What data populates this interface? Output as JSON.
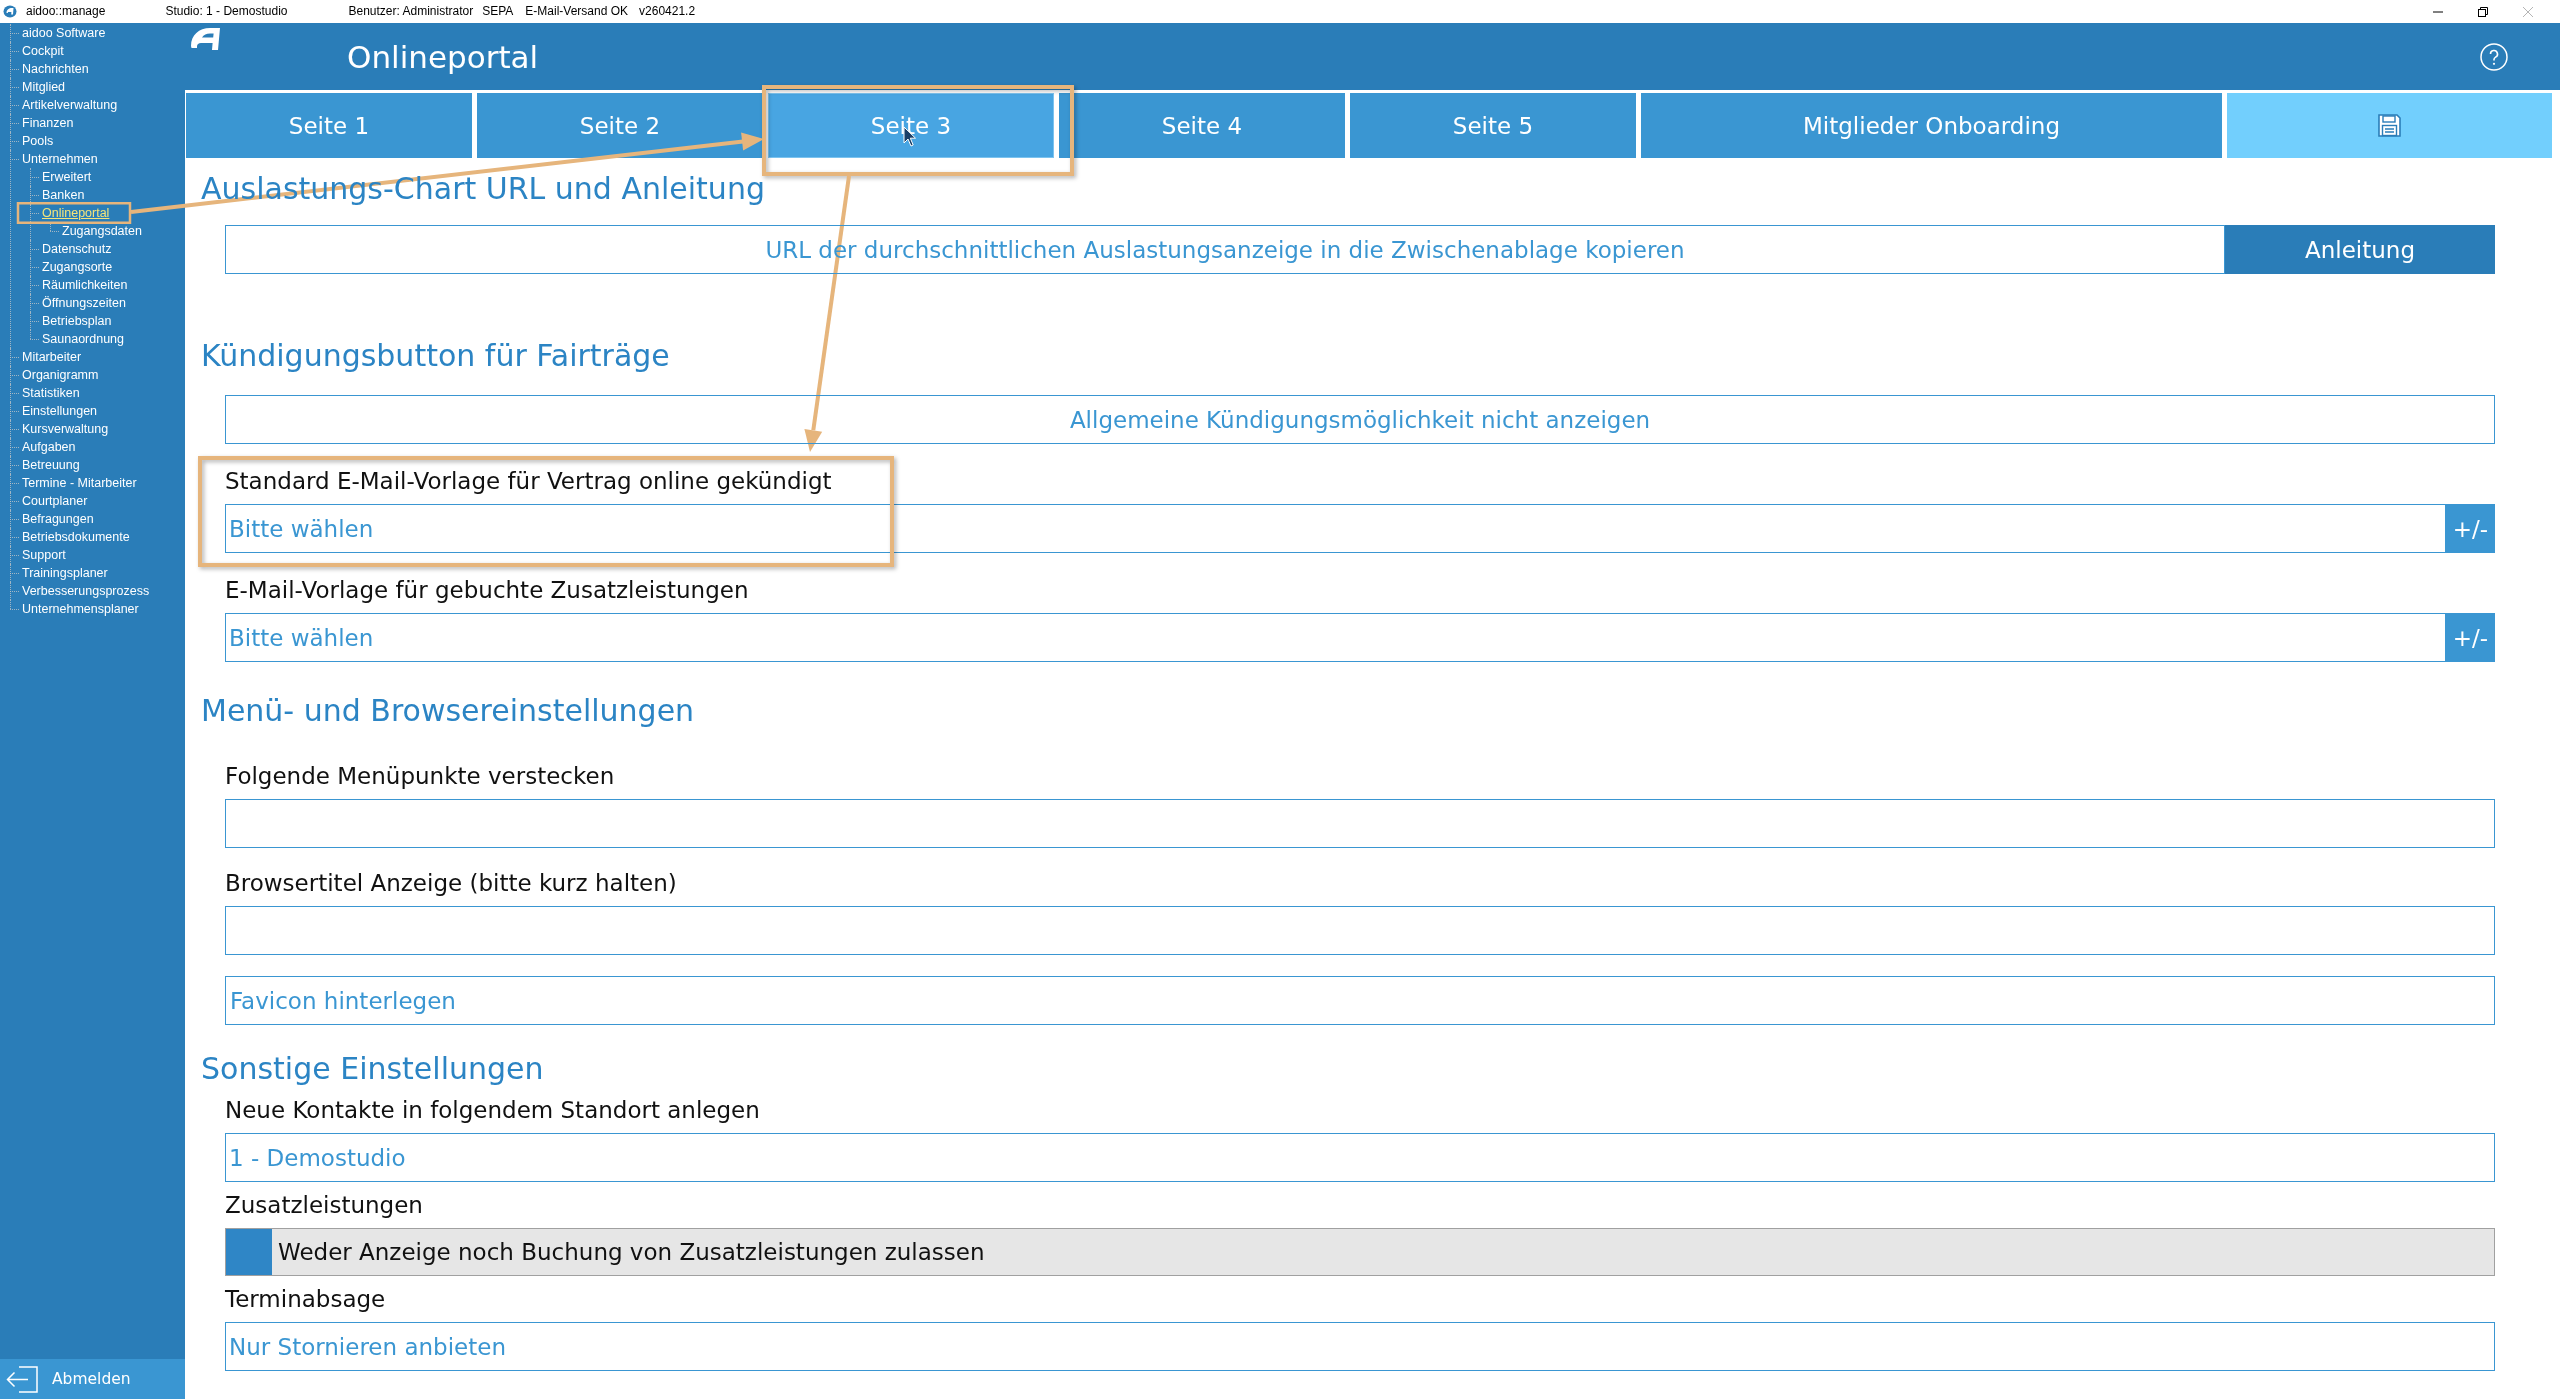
{
  "title_bar": {
    "app": "aidoo::manage",
    "studio": "Studio: 1 - Demostudio",
    "user": "Benutzer: Administrator",
    "sepa": "SEPA",
    "mail_status": "E-Mail-Versand OK",
    "version": "v260421.2"
  },
  "sidebar": {
    "items": [
      {
        "label": "aidoo Software",
        "selected": false
      },
      {
        "label": "Cockpit",
        "selected": false
      },
      {
        "label": "Nachrichten",
        "selected": false
      },
      {
        "label": "Mitglied",
        "selected": false
      },
      {
        "label": "Artikelverwaltung",
        "selected": false
      },
      {
        "label": "Finanzen",
        "selected": false
      },
      {
        "label": "Pools",
        "selected": false
      },
      {
        "label": "Unternehmen",
        "selected": false,
        "children": [
          {
            "label": "Erweitert",
            "selected": false
          },
          {
            "label": "Banken",
            "selected": false
          },
          {
            "label": "Onlineportal",
            "selected": true,
            "children": [
              {
                "label": "Zugangsdaten",
                "selected": false
              }
            ]
          },
          {
            "label": "Datenschutz",
            "selected": false
          },
          {
            "label": "Zugangsorte",
            "selected": false
          },
          {
            "label": "Räumlichkeiten",
            "selected": false
          },
          {
            "label": "Öffnungszeiten",
            "selected": false
          },
          {
            "label": "Betriebsplan",
            "selected": false
          },
          {
            "label": "Saunaordnung",
            "selected": false
          }
        ]
      },
      {
        "label": "Mitarbeiter",
        "selected": false
      },
      {
        "label": "Organigramm",
        "selected": false
      },
      {
        "label": "Statistiken",
        "selected": false
      },
      {
        "label": "Einstellungen",
        "selected": false
      },
      {
        "label": "Kursverwaltung",
        "selected": false
      },
      {
        "label": "Aufgaben",
        "selected": false
      },
      {
        "label": "Betreuung",
        "selected": false
      },
      {
        "label": "Termine - Mitarbeiter",
        "selected": false
      },
      {
        "label": "Courtplaner",
        "selected": false
      },
      {
        "label": "Befragungen",
        "selected": false
      },
      {
        "label": "Betriebsdokumente",
        "selected": false
      },
      {
        "label": "Support",
        "selected": false
      },
      {
        "label": "Trainingsplaner",
        "selected": false
      },
      {
        "label": "Verbesserungsprozess",
        "selected": false
      },
      {
        "label": "Unternehmensplaner",
        "selected": false
      }
    ],
    "logout": "Abmelden"
  },
  "header": {
    "title": "Onlineportal"
  },
  "tabs": [
    {
      "label": "Seite 1",
      "selected": false
    },
    {
      "label": "Seite 2",
      "selected": false
    },
    {
      "label": "Seite 3",
      "selected": true
    },
    {
      "label": "Seite 4",
      "selected": false
    },
    {
      "label": "Seite 5",
      "selected": false
    },
    {
      "label": "Mitglieder Onboarding",
      "selected": false
    }
  ],
  "sections": [
    {
      "heading": "Auslastungs-Chart URL und Anleitung",
      "fields": [
        {
          "kind": "button_pair",
          "button": "URL der durchschnittlichen Auslastungsanzeige in die Zwischenablage kopieren",
          "side_button": "Anleitung"
        }
      ]
    },
    {
      "heading": "Kündigungsbutton für Fairträge",
      "fields": [
        {
          "kind": "button",
          "button": "Allgemeine Kündigungsmöglichkeit nicht anzeigen"
        },
        {
          "kind": "select",
          "label": "Standard E-Mail-Vorlage für Vertrag online gekündigt",
          "value": "Bitte wählen",
          "side_button": "+/-"
        },
        {
          "kind": "select",
          "label": "E-Mail-Vorlage für gebuchte Zusatzleistungen",
          "value": "Bitte wählen",
          "side_button": "+/-"
        }
      ]
    },
    {
      "heading": "Menü- und Browsereinstellungen",
      "fields": [
        {
          "kind": "input",
          "label": "Folgende Menüpunkte verstecken"
        },
        {
          "kind": "input",
          "label": "Browsertitel Anzeige (bitte kurz halten)"
        },
        {
          "kind": "file_button",
          "button": "Favicon hinterlegen"
        }
      ]
    },
    {
      "heading": "Sonstige Einstellungen",
      "fields": [
        {
          "kind": "select",
          "label": "Neue Kontakte in folgendem Standort anlegen",
          "value": "1 - Demostudio"
        },
        {
          "kind": "checkbox",
          "label": "Zusatzleistungen",
          "text": "Weder Anzeige noch Buchung von Zusatzleistungen zulassen",
          "checked": true
        },
        {
          "kind": "select",
          "label": "Terminabsage",
          "value": "Nur Stornieren anbieten"
        }
      ]
    }
  ]
}
